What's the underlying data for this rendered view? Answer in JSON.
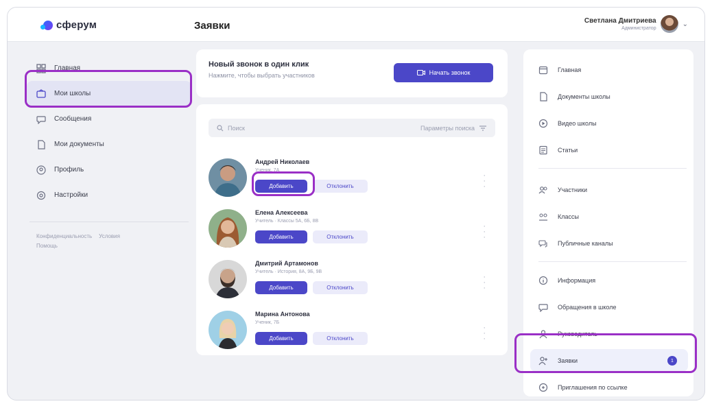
{
  "app": {
    "brand": "сферум",
    "page_title": "Заявки"
  },
  "user": {
    "name": "Светлана Дмитриева",
    "role": "Администратор",
    "menu_chevron": "chevron-down-icon"
  },
  "left_nav": {
    "items": [
      {
        "label": "Главная",
        "icon": "grid-icon",
        "active": false
      },
      {
        "label": "Мои школы",
        "icon": "school-icon",
        "active": true
      },
      {
        "label": "Сообщения",
        "icon": "chat-icon",
        "active": false
      },
      {
        "label": "Мои документы",
        "icon": "document-icon",
        "active": false
      },
      {
        "label": "Профиль",
        "icon": "profile-icon",
        "active": false
      },
      {
        "label": "Настройки",
        "icon": "settings-icon",
        "active": false
      }
    ],
    "footer": [
      "Конфиденциальность",
      "Условия",
      "Помощь"
    ]
  },
  "new_call": {
    "title": "Новый звонок в один клик",
    "subtitle": "Нажмите, чтобы выбрать участников",
    "button_label": "Начать звонок"
  },
  "search": {
    "placeholder": "Поиск",
    "params_label": "Параметры поиска"
  },
  "requests": {
    "add_label": "Добавить",
    "decline_label": "Отклонить",
    "items": [
      {
        "name": "Андрей Николаев",
        "role": "Ученик, 7А"
      },
      {
        "name": "Елена Алексеева",
        "role": "Учитель · Классы 5А, 6Б, 8В"
      },
      {
        "name": "Дмитрий Артамонов",
        "role": "Учитель · История, 8А, 9Б, 9В"
      },
      {
        "name": "Марина Антонова",
        "role": "Ученик, 7Б"
      }
    ]
  },
  "right_panel": {
    "items": [
      {
        "label": "Главная",
        "icon": "calendar-icon"
      },
      {
        "label": "Документы школы",
        "icon": "document-icon"
      },
      {
        "label": "Видео школы",
        "icon": "play-icon"
      },
      {
        "label": "Статьи",
        "icon": "article-icon"
      },
      {
        "label": "Участники",
        "icon": "users-icon"
      },
      {
        "label": "Классы",
        "icon": "classes-icon"
      },
      {
        "label": "Публичные каналы",
        "icon": "channels-icon"
      },
      {
        "label": "Информация",
        "icon": "info-icon"
      },
      {
        "label": "Обращения в школе",
        "icon": "message-icon"
      },
      {
        "label": "Руководитель",
        "icon": "person-icon"
      },
      {
        "label": "Заявки",
        "icon": "add-user-icon",
        "active": true,
        "badge": "1"
      },
      {
        "label": "Приглашения по ссылке",
        "icon": "link-icon"
      }
    ]
  },
  "colors": {
    "accent": "#4b47c8",
    "highlight_ring": "#9a2fc6",
    "background": "#f0f1f5"
  }
}
